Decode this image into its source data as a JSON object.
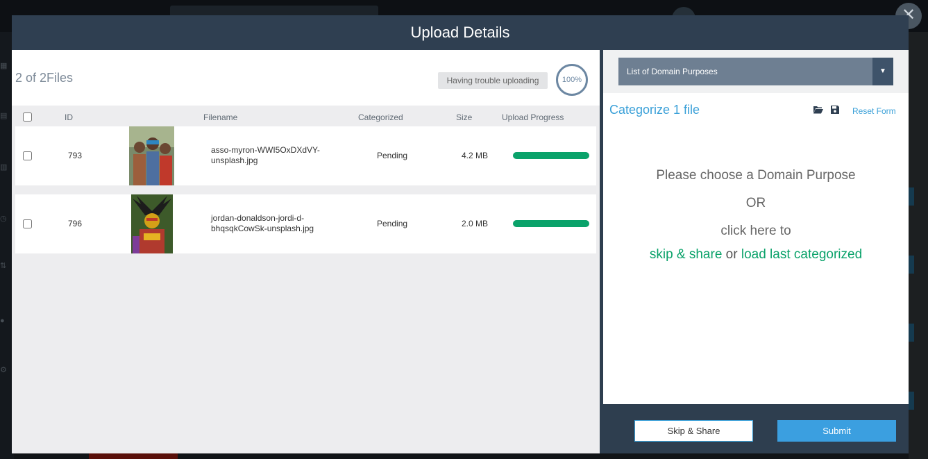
{
  "modal": {
    "title": "Upload Details",
    "close_glyph": "✕",
    "file_count": "2 of 2Files",
    "trouble_label": "Having trouble uploading",
    "overall_progress": "100%",
    "table": {
      "headers": [
        "ID",
        "Filename",
        "Categorized",
        "Size",
        "Upload Progress"
      ],
      "rows": [
        {
          "id": "793",
          "filename": "asso-myron-WWI5OxDXdVY-unsplash.jpg",
          "status": "Pending",
          "size": "4.2 MB",
          "progress": 1.0
        },
        {
          "id": "796",
          "filename": "jordan-donaldson-jordi-d-bhqsqkCowSk-unsplash.jpg",
          "status": "Pending",
          "size": "2.0 MB",
          "progress": 1.0
        }
      ]
    },
    "right": {
      "domain_select_label": "List of Domain Purposes",
      "categorize_title": "Categorize 1 file",
      "reset_label": "Reset Form",
      "msg_choose": "Please choose a Domain Purpose",
      "msg_or": "OR",
      "msg_click": "click here to",
      "link_skip": "skip & share",
      "link_joiner": "or",
      "link_load": "load last categorized"
    },
    "footer": {
      "skip_label": "Skip & Share",
      "submit_label": "Submit"
    }
  },
  "colors": {
    "accent_blue": "#3aa0d8",
    "progress_green": "#0aa26a",
    "header_bg": "#2f3f51"
  },
  "icons": [
    "close-icon",
    "folder-open-icon",
    "save-icon",
    "caret-down-icon"
  ]
}
